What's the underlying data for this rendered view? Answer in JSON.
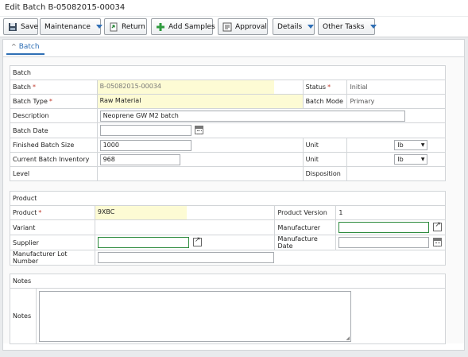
{
  "page": {
    "title": "Edit Batch B-05082015-00034"
  },
  "toolbar": {
    "save": "Save",
    "maintenance": "Maintenance",
    "return": "Return",
    "add_samples": "Add Samples",
    "approval": "Approval",
    "details": "Details",
    "other_tasks": "Other Tasks"
  },
  "tabs": {
    "batch": "Batch"
  },
  "batch_section": {
    "heading": "Batch",
    "batch_label": "Batch",
    "batch_value": "B-05082015-00034",
    "status_label": "Status",
    "status_value": "Initial",
    "batch_type_label": "Batch Type",
    "batch_type_value": "Raw Material",
    "batch_mode_label": "Batch Mode",
    "batch_mode_value": "Primary",
    "description_label": "Description",
    "description_value": "Neoprene GW M2 batch",
    "batch_date_label": "Batch Date",
    "batch_date_value": "",
    "finished_size_label": "Finished Batch Size",
    "finished_size_value": "1000",
    "unit_label": "Unit",
    "unit1_value": "lb",
    "current_inv_label": "Current Batch Inventory",
    "current_inv_value": "968",
    "unit2_value": "lb",
    "level_label": "Level",
    "disposition_label": "Disposition"
  },
  "product_section": {
    "heading": "Product",
    "product_label": "Product",
    "product_value": "9XBC",
    "product_version_label": "Product Version",
    "product_version_value": "1",
    "variant_label": "Variant",
    "manufacturer_label": "Manufacturer",
    "manufacturer_value": "",
    "supplier_label": "Supplier",
    "supplier_value": "",
    "manufacture_date_label": "Manufacture Date",
    "manufacture_date_value": "",
    "mfr_lot_label": "Manufacturer Lot Number",
    "mfr_lot_value": ""
  },
  "notes_section": {
    "heading": "Notes",
    "notes_label": "Notes",
    "notes_value": ""
  },
  "icons": [
    "save-icon",
    "return-icon",
    "add-icon",
    "approval-icon",
    "calendar-icon",
    "open-link-icon"
  ],
  "colors": {
    "accent": "#2f6fb5",
    "required": "#c0392b",
    "readonly_fill": "#fdfbd4",
    "lookup_border": "#2e8b3e"
  }
}
